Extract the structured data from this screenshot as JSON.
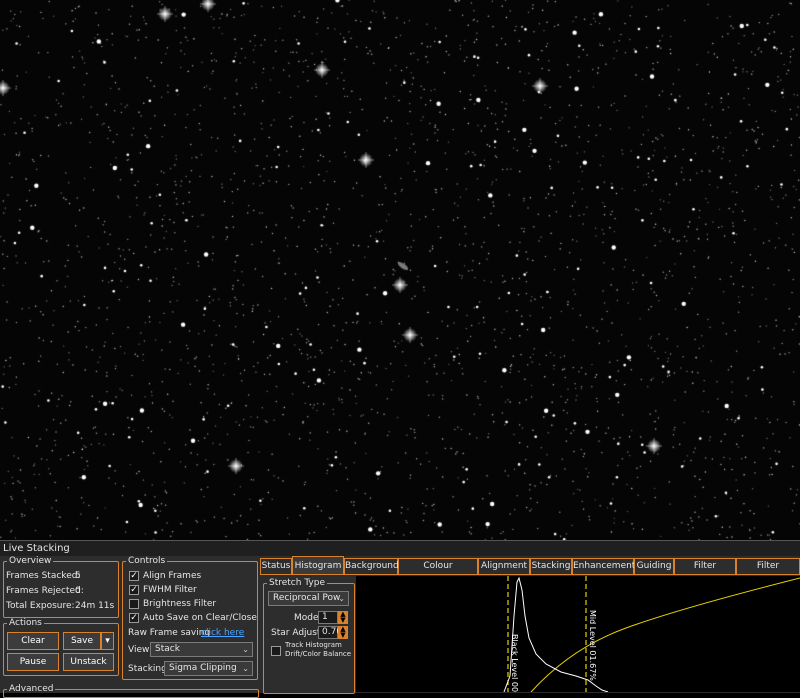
{
  "live_stacking": {
    "title": "Live Stacking"
  },
  "overview": {
    "legend": "Overview",
    "frames_stacked_label": "Frames Stacked:",
    "frames_stacked": "5",
    "frames_rejected_label": "Frames Rejected:",
    "frames_rejected": "0",
    "total_exposure_label": "Total Exposure:",
    "total_exposure": "24m 11s"
  },
  "actions": {
    "legend": "Actions",
    "clear": "Clear",
    "save": "Save",
    "save_arrow": "▾",
    "pause": "Pause",
    "unstack": "Unstack"
  },
  "controls": {
    "legend": "Controls",
    "align_frames": "Align Frames",
    "align_frames_checked": true,
    "fwhm_filter": "FWHM Filter",
    "fwhm_filter_checked": true,
    "brightness_filter": "Brightness Filter",
    "brightness_filter_checked": false,
    "auto_save": "Auto Save on Clear/Close",
    "auto_save_checked": true,
    "raw_frame_label": "Raw Frame saving",
    "raw_frame_link": "click here",
    "view_label": "View",
    "view_value": "Stack",
    "stacking_label": "Stacking",
    "stacking_value": "Sigma Clipping"
  },
  "advanced": {
    "legend": "Advanced"
  },
  "tabs": [
    "Status",
    "Histogram",
    "Background",
    "Colour Calibration",
    "Alignment",
    "Stacking",
    "Enhancement",
    "Guiding",
    "Filter (FWHM)",
    "Filter (Brightne"
  ],
  "active_tab": "Histogram",
  "histogram": {
    "stretch_legend": "Stretch Type",
    "stretch_value": "Reciprocal Pow",
    "mode_label": "Mode",
    "mode_value": "1",
    "star_adjust_label": "Star Adjust",
    "star_adjust_value": "0.70",
    "track_histogram": "Track Histogram",
    "drift_balance": "Drift/Color Balance",
    "black_level_label": "Black Level 00.1",
    "mid_level_label": "Mid Level 01.67%"
  },
  "colors": {
    "accent": "#d9822b",
    "panel": "#2d2d2d",
    "curve": "#e6d000",
    "link": "#4aa3ff"
  },
  "icons": {
    "checkbox": "check-icon",
    "dropdown": "chevron-down-icon",
    "spinner": "spinner-arrows-icon"
  }
}
